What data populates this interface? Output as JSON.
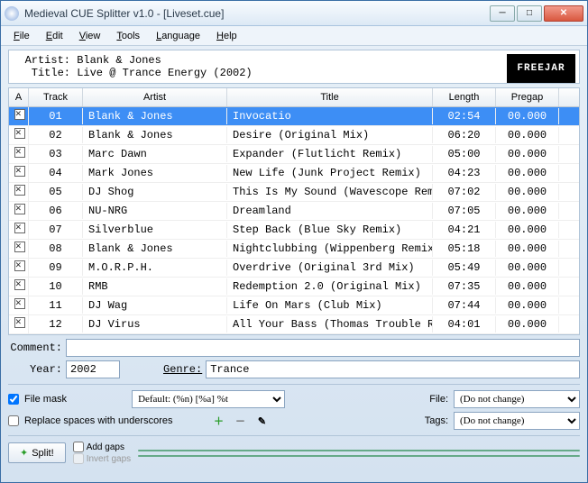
{
  "window": {
    "title": "Medieval CUE Splitter v1.0 - [Liveset.cue]"
  },
  "menu": {
    "file": "File",
    "edit": "Edit",
    "view": "View",
    "tools": "Tools",
    "language": "Language",
    "help": "Help"
  },
  "header": {
    "artist_label": "Artist:",
    "artist": "Blank & Jones",
    "title_label": "Title:",
    "title": "Live @ Trance Energy (2002)",
    "logo": "FREEJAR"
  },
  "columns": {
    "a": "A",
    "track": "Track",
    "artist": "Artist",
    "title": "Title",
    "length": "Length",
    "pregap": "Pregap"
  },
  "tracks": [
    {
      "n": "01",
      "artist": "Blank & Jones",
      "title": "Invocatio",
      "length": "02:54",
      "pregap": "00.000",
      "sel": true
    },
    {
      "n": "02",
      "artist": "Blank & Jones",
      "title": "Desire (Original Mix)",
      "length": "06:20",
      "pregap": "00.000"
    },
    {
      "n": "03",
      "artist": "Marc Dawn",
      "title": "Expander (Flutlicht Remix)",
      "length": "05:00",
      "pregap": "00.000"
    },
    {
      "n": "04",
      "artist": "Mark Jones",
      "title": "New Life (Junk Project Remix)",
      "length": "04:23",
      "pregap": "00.000"
    },
    {
      "n": "05",
      "artist": "DJ Shog",
      "title": "This Is My Sound (Wavescope Remix)",
      "length": "07:02",
      "pregap": "00.000"
    },
    {
      "n": "06",
      "artist": "NU-NRG",
      "title": "Dreamland",
      "length": "07:05",
      "pregap": "00.000"
    },
    {
      "n": "07",
      "artist": "Silverblue",
      "title": "Step Back (Blue Sky Remix)",
      "length": "04:21",
      "pregap": "00.000"
    },
    {
      "n": "08",
      "artist": "Blank & Jones",
      "title": "Nightclubbing (Wippenberg Remix)",
      "length": "05:18",
      "pregap": "00.000"
    },
    {
      "n": "09",
      "artist": "M.O.R.P.H.",
      "title": "Overdrive (Original 3rd Mix)",
      "length": "05:49",
      "pregap": "00.000"
    },
    {
      "n": "10",
      "artist": "RMB",
      "title": "Redemption 2.0 (Original Mix)",
      "length": "07:35",
      "pregap": "00.000"
    },
    {
      "n": "11",
      "artist": "DJ Wag",
      "title": "Life On Mars (Club Mix)",
      "length": "07:44",
      "pregap": "00.000"
    },
    {
      "n": "12",
      "artist": "DJ Virus",
      "title": "All Your Bass (Thomas Trouble Remix)",
      "length": "04:01",
      "pregap": "00.000"
    }
  ],
  "form": {
    "comment_label": "Comment:",
    "comment": "",
    "year_label": "Year:",
    "year": "2002",
    "genre_label": "Genre:",
    "genre": "Trance"
  },
  "options": {
    "file_mask_label": "File mask",
    "file_mask_preset": "Default: (%n) [%a] %t",
    "replace_spaces_label": "Replace spaces with underscores",
    "file_label": "File:",
    "file_value": "(Do not change)",
    "tags_label": "Tags:",
    "tags_value": "(Do not change)"
  },
  "split": {
    "button": "Split!",
    "add_gaps": "Add gaps",
    "invert_gaps": "Invert gaps"
  }
}
